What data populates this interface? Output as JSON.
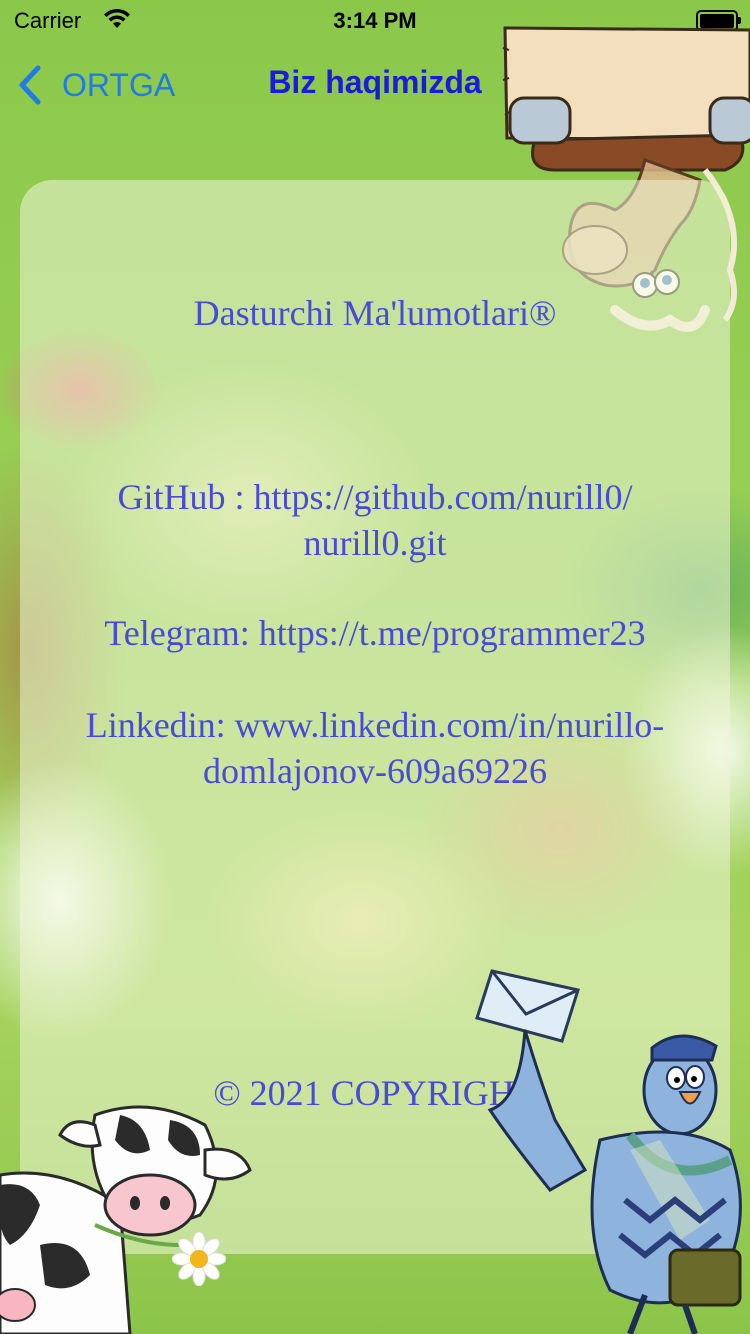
{
  "status_bar": {
    "carrier": "Carrier",
    "time": "3:14 PM"
  },
  "nav": {
    "back_label": "ORTGA",
    "title": "Biz haqimizda",
    "back_icon": "chevron-left-icon",
    "accent_color": "#1f7ce6",
    "title_color": "#1b1bdb"
  },
  "content": {
    "header": "Dasturchi Ma'lumotlari®",
    "github_line1": "GitHub  : https://github.com/nurill0/",
    "github_line2": "nurill0.git",
    "telegram": "Telegram: https://t.me/programmer23",
    "linkedin_line1": "Linkedin: www.linkedin.com/in/nurillo-",
    "linkedin_line2": "domlajonov-609a69226",
    "copyright": "© 2021 COPYRIGHT",
    "text_color": "#4a4ad9"
  },
  "illustrations": [
    "horse-with-sign-icon",
    "cow-icon",
    "pigeon-mail-icon",
    "envelope-icon",
    "daisy-flower-icon"
  ]
}
